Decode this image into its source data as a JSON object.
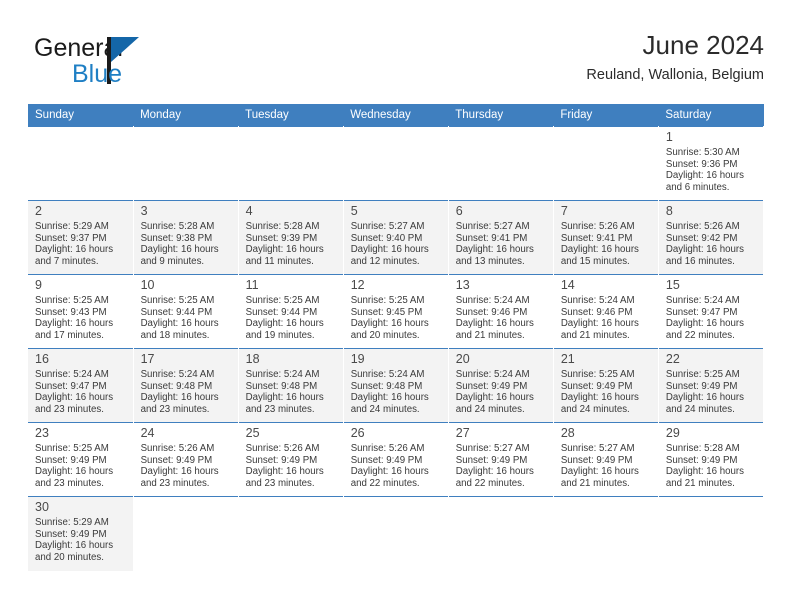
{
  "brand": {
    "name_part1": "General",
    "name_part2": "Blue",
    "flag_icon": "brand-flag-icon"
  },
  "header": {
    "title": "June 2024",
    "subtitle": "Reuland, Wallonia, Belgium"
  },
  "colors": {
    "header_blue": "#3f7fbf",
    "brand_blue": "#1f7fc4",
    "shaded_row": "#f3f3f3",
    "text": "#3a3a3a"
  },
  "weekdays": [
    "Sunday",
    "Monday",
    "Tuesday",
    "Wednesday",
    "Thursday",
    "Friday",
    "Saturday"
  ],
  "weeks": [
    {
      "shaded": false,
      "days": [
        null,
        null,
        null,
        null,
        null,
        null,
        {
          "day": "1",
          "sunrise": "Sunrise: 5:30 AM",
          "sunset": "Sunset: 9:36 PM",
          "daylight_l1": "Daylight: 16 hours",
          "daylight_l2": "and 6 minutes."
        }
      ]
    },
    {
      "shaded": true,
      "days": [
        {
          "day": "2",
          "sunrise": "Sunrise: 5:29 AM",
          "sunset": "Sunset: 9:37 PM",
          "daylight_l1": "Daylight: 16 hours",
          "daylight_l2": "and 7 minutes."
        },
        {
          "day": "3",
          "sunrise": "Sunrise: 5:28 AM",
          "sunset": "Sunset: 9:38 PM",
          "daylight_l1": "Daylight: 16 hours",
          "daylight_l2": "and 9 minutes."
        },
        {
          "day": "4",
          "sunrise": "Sunrise: 5:28 AM",
          "sunset": "Sunset: 9:39 PM",
          "daylight_l1": "Daylight: 16 hours",
          "daylight_l2": "and 11 minutes."
        },
        {
          "day": "5",
          "sunrise": "Sunrise: 5:27 AM",
          "sunset": "Sunset: 9:40 PM",
          "daylight_l1": "Daylight: 16 hours",
          "daylight_l2": "and 12 minutes."
        },
        {
          "day": "6",
          "sunrise": "Sunrise: 5:27 AM",
          "sunset": "Sunset: 9:41 PM",
          "daylight_l1": "Daylight: 16 hours",
          "daylight_l2": "and 13 minutes."
        },
        {
          "day": "7",
          "sunrise": "Sunrise: 5:26 AM",
          "sunset": "Sunset: 9:41 PM",
          "daylight_l1": "Daylight: 16 hours",
          "daylight_l2": "and 15 minutes."
        },
        {
          "day": "8",
          "sunrise": "Sunrise: 5:26 AM",
          "sunset": "Sunset: 9:42 PM",
          "daylight_l1": "Daylight: 16 hours",
          "daylight_l2": "and 16 minutes."
        }
      ]
    },
    {
      "shaded": false,
      "days": [
        {
          "day": "9",
          "sunrise": "Sunrise: 5:25 AM",
          "sunset": "Sunset: 9:43 PM",
          "daylight_l1": "Daylight: 16 hours",
          "daylight_l2": "and 17 minutes."
        },
        {
          "day": "10",
          "sunrise": "Sunrise: 5:25 AM",
          "sunset": "Sunset: 9:44 PM",
          "daylight_l1": "Daylight: 16 hours",
          "daylight_l2": "and 18 minutes."
        },
        {
          "day": "11",
          "sunrise": "Sunrise: 5:25 AM",
          "sunset": "Sunset: 9:44 PM",
          "daylight_l1": "Daylight: 16 hours",
          "daylight_l2": "and 19 minutes."
        },
        {
          "day": "12",
          "sunrise": "Sunrise: 5:25 AM",
          "sunset": "Sunset: 9:45 PM",
          "daylight_l1": "Daylight: 16 hours",
          "daylight_l2": "and 20 minutes."
        },
        {
          "day": "13",
          "sunrise": "Sunrise: 5:24 AM",
          "sunset": "Sunset: 9:46 PM",
          "daylight_l1": "Daylight: 16 hours",
          "daylight_l2": "and 21 minutes."
        },
        {
          "day": "14",
          "sunrise": "Sunrise: 5:24 AM",
          "sunset": "Sunset: 9:46 PM",
          "daylight_l1": "Daylight: 16 hours",
          "daylight_l2": "and 21 minutes."
        },
        {
          "day": "15",
          "sunrise": "Sunrise: 5:24 AM",
          "sunset": "Sunset: 9:47 PM",
          "daylight_l1": "Daylight: 16 hours",
          "daylight_l2": "and 22 minutes."
        }
      ]
    },
    {
      "shaded": true,
      "days": [
        {
          "day": "16",
          "sunrise": "Sunrise: 5:24 AM",
          "sunset": "Sunset: 9:47 PM",
          "daylight_l1": "Daylight: 16 hours",
          "daylight_l2": "and 23 minutes."
        },
        {
          "day": "17",
          "sunrise": "Sunrise: 5:24 AM",
          "sunset": "Sunset: 9:48 PM",
          "daylight_l1": "Daylight: 16 hours",
          "daylight_l2": "and 23 minutes."
        },
        {
          "day": "18",
          "sunrise": "Sunrise: 5:24 AM",
          "sunset": "Sunset: 9:48 PM",
          "daylight_l1": "Daylight: 16 hours",
          "daylight_l2": "and 23 minutes."
        },
        {
          "day": "19",
          "sunrise": "Sunrise: 5:24 AM",
          "sunset": "Sunset: 9:48 PM",
          "daylight_l1": "Daylight: 16 hours",
          "daylight_l2": "and 24 minutes."
        },
        {
          "day": "20",
          "sunrise": "Sunrise: 5:24 AM",
          "sunset": "Sunset: 9:49 PM",
          "daylight_l1": "Daylight: 16 hours",
          "daylight_l2": "and 24 minutes."
        },
        {
          "day": "21",
          "sunrise": "Sunrise: 5:25 AM",
          "sunset": "Sunset: 9:49 PM",
          "daylight_l1": "Daylight: 16 hours",
          "daylight_l2": "and 24 minutes."
        },
        {
          "day": "22",
          "sunrise": "Sunrise: 5:25 AM",
          "sunset": "Sunset: 9:49 PM",
          "daylight_l1": "Daylight: 16 hours",
          "daylight_l2": "and 24 minutes."
        }
      ]
    },
    {
      "shaded": false,
      "days": [
        {
          "day": "23",
          "sunrise": "Sunrise: 5:25 AM",
          "sunset": "Sunset: 9:49 PM",
          "daylight_l1": "Daylight: 16 hours",
          "daylight_l2": "and 23 minutes."
        },
        {
          "day": "24",
          "sunrise": "Sunrise: 5:26 AM",
          "sunset": "Sunset: 9:49 PM",
          "daylight_l1": "Daylight: 16 hours",
          "daylight_l2": "and 23 minutes."
        },
        {
          "day": "25",
          "sunrise": "Sunrise: 5:26 AM",
          "sunset": "Sunset: 9:49 PM",
          "daylight_l1": "Daylight: 16 hours",
          "daylight_l2": "and 23 minutes."
        },
        {
          "day": "26",
          "sunrise": "Sunrise: 5:26 AM",
          "sunset": "Sunset: 9:49 PM",
          "daylight_l1": "Daylight: 16 hours",
          "daylight_l2": "and 22 minutes."
        },
        {
          "day": "27",
          "sunrise": "Sunrise: 5:27 AM",
          "sunset": "Sunset: 9:49 PM",
          "daylight_l1": "Daylight: 16 hours",
          "daylight_l2": "and 22 minutes."
        },
        {
          "day": "28",
          "sunrise": "Sunrise: 5:27 AM",
          "sunset": "Sunset: 9:49 PM",
          "daylight_l1": "Daylight: 16 hours",
          "daylight_l2": "and 21 minutes."
        },
        {
          "day": "29",
          "sunrise": "Sunrise: 5:28 AM",
          "sunset": "Sunset: 9:49 PM",
          "daylight_l1": "Daylight: 16 hours",
          "daylight_l2": "and 21 minutes."
        }
      ]
    },
    {
      "shaded": true,
      "days": [
        {
          "day": "30",
          "sunrise": "Sunrise: 5:29 AM",
          "sunset": "Sunset: 9:49 PM",
          "daylight_l1": "Daylight: 16 hours",
          "daylight_l2": "and 20 minutes."
        },
        null,
        null,
        null,
        null,
        null,
        null
      ]
    }
  ]
}
